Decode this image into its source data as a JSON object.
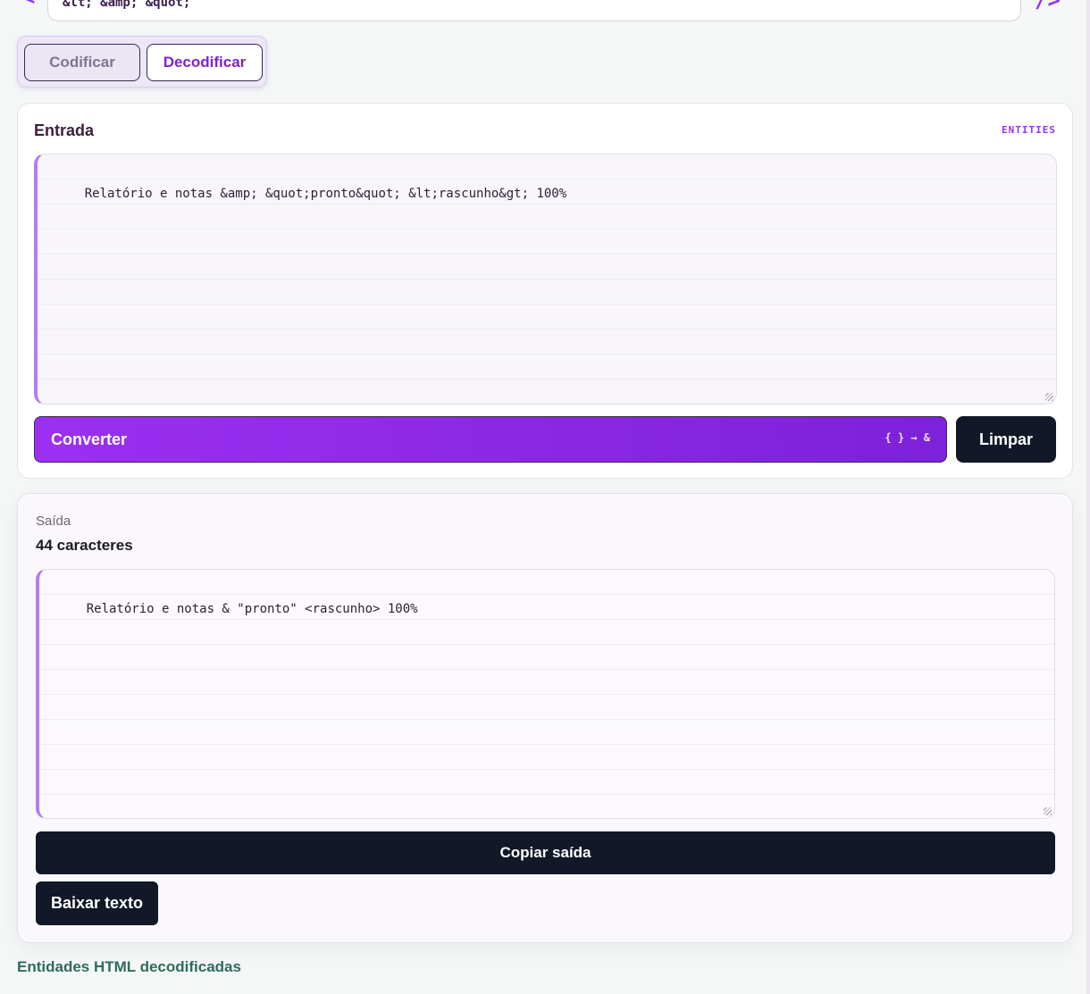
{
  "sample": {
    "text": "&lt; &amp; &quot;",
    "left_icon": "<",
    "right_icon": "/>"
  },
  "mode": {
    "encode_label": "Codificar",
    "decode_label": "Decodificar"
  },
  "input_card": {
    "title": "Entrada",
    "tag": "ENTITIES",
    "value": "Relatório e notas &amp; &quot;pronto&quot; &lt;rascunho&gt; 100%",
    "convert_label": "Converter",
    "convert_hint": "{ } → &",
    "clear_label": "Limpar"
  },
  "output_card": {
    "label": "Saída",
    "count": "44 caracteres",
    "value": "Relatório e notas & \"pronto\" <rascunho> 100%",
    "copy_label": "Copiar saída",
    "download_label": "Baixar texto"
  },
  "status": {
    "text": "Entidades HTML decodificadas"
  },
  "colors": {
    "accent": "#9333ea",
    "dark_button": "#121827",
    "status_text": "#2f6b5e"
  }
}
